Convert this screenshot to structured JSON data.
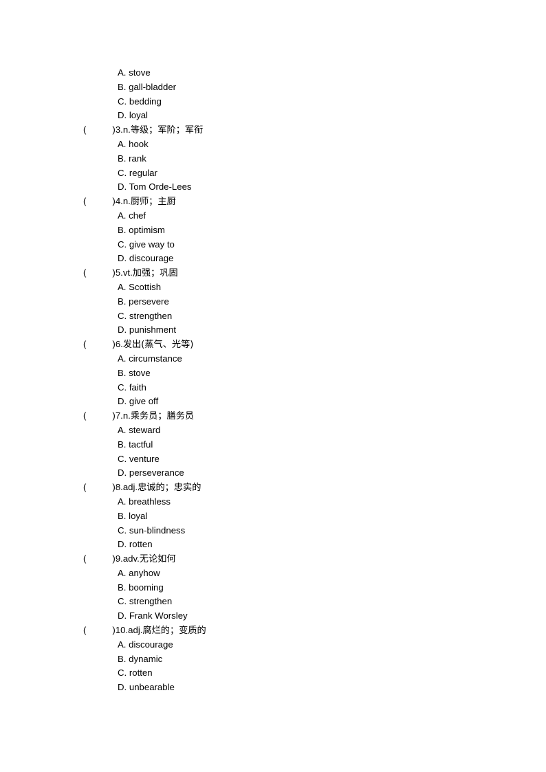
{
  "document": {
    "type": "vocabulary-multiple-choice-worksheet",
    "language": "zh-CN / en",
    "page_background": "#ffffff",
    "text_color": "#000000"
  },
  "leading_options": [
    {
      "label": "A.",
      "text": "stove"
    },
    {
      "label": "B.",
      "text": "gall-bladder"
    },
    {
      "label": "C.",
      "text": "bedding"
    },
    {
      "label": "D.",
      "text": "loyal"
    }
  ],
  "questions": [
    {
      "paren_open": "(",
      "paren_close": ")",
      "number": "3.",
      "pos": "n.",
      "prompt": "等级；军阶；军衔",
      "options": [
        {
          "label": "A.",
          "text": "hook"
        },
        {
          "label": "B.",
          "text": "rank"
        },
        {
          "label": "C.",
          "text": "regular"
        },
        {
          "label": "D.",
          "text": "Tom Orde-Lees"
        }
      ]
    },
    {
      "paren_open": "(",
      "paren_close": ")",
      "number": "4.",
      "pos": "n.",
      "prompt": "厨师；主厨",
      "options": [
        {
          "label": "A.",
          "text": "chef"
        },
        {
          "label": "B.",
          "text": "optimism"
        },
        {
          "label": "C.",
          "text": "give way to"
        },
        {
          "label": "D.",
          "text": "discourage"
        }
      ]
    },
    {
      "paren_open": "(",
      "paren_close": ")",
      "number": "5.",
      "pos": "vt.",
      "prompt": "加强；巩固",
      "options": [
        {
          "label": "A.",
          "text": "Scottish"
        },
        {
          "label": "B.",
          "text": "persevere"
        },
        {
          "label": "C.",
          "text": "strengthen"
        },
        {
          "label": "D.",
          "text": "punishment"
        }
      ]
    },
    {
      "paren_open": "(",
      "paren_close": ")",
      "number": "6.",
      "pos": "",
      "prompt": "发出(蒸气、光等)",
      "options": [
        {
          "label": "A.",
          "text": "circumstance"
        },
        {
          "label": "B.",
          "text": "stove"
        },
        {
          "label": "C.",
          "text": "faith"
        },
        {
          "label": "D.",
          "text": "give off"
        }
      ]
    },
    {
      "paren_open": "(",
      "paren_close": ")",
      "number": "7.",
      "pos": "n.",
      "prompt": "乘务员；膳务员",
      "options": [
        {
          "label": "A.",
          "text": "steward"
        },
        {
          "label": "B.",
          "text": "tactful"
        },
        {
          "label": "C.",
          "text": "venture"
        },
        {
          "label": "D.",
          "text": "perseverance"
        }
      ]
    },
    {
      "paren_open": "(",
      "paren_close": ")",
      "number": "8.",
      "pos": "adj.",
      "prompt": "忠诚的；忠实的",
      "options": [
        {
          "label": "A.",
          "text": "breathless"
        },
        {
          "label": "B.",
          "text": "loyal"
        },
        {
          "label": "C.",
          "text": "sun-blindness"
        },
        {
          "label": "D.",
          "text": "rotten"
        }
      ]
    },
    {
      "paren_open": "(",
      "paren_close": ")",
      "number": "9.",
      "pos": "adv.",
      "prompt": "无论如何",
      "options": [
        {
          "label": "A.",
          "text": "anyhow"
        },
        {
          "label": "B.",
          "text": "booming"
        },
        {
          "label": "C.",
          "text": "strengthen"
        },
        {
          "label": "D.",
          "text": "Frank Worsley"
        }
      ]
    },
    {
      "paren_open": "(",
      "paren_close": ")",
      "number": "10.",
      "pos": "adj.",
      "prompt": "腐烂的；变质的",
      "options": [
        {
          "label": "A.",
          "text": "discourage"
        },
        {
          "label": "B.",
          "text": "dynamic"
        },
        {
          "label": "C.",
          "text": "rotten"
        },
        {
          "label": "D.",
          "text": "unbearable"
        }
      ]
    }
  ]
}
